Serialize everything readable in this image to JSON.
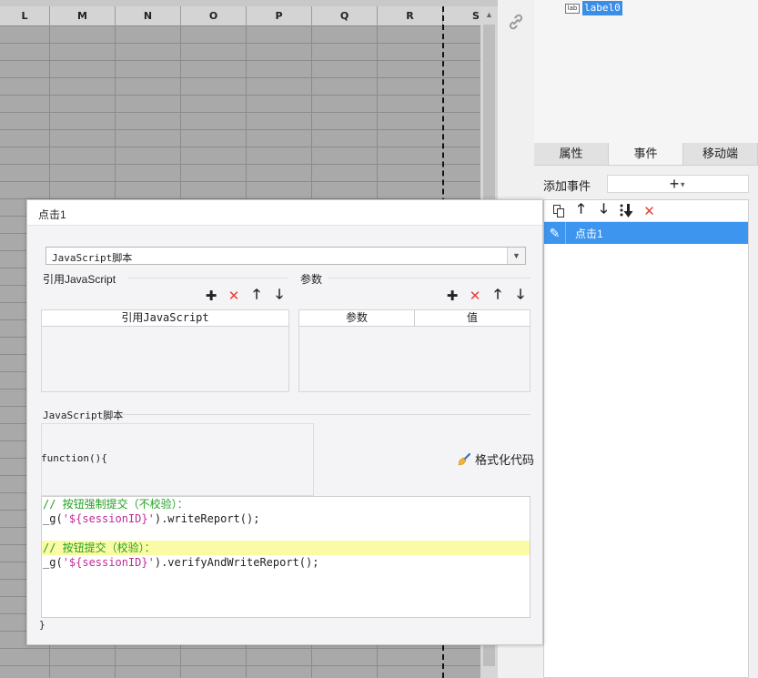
{
  "spreadsheet": {
    "columns": [
      "L",
      "M",
      "N",
      "O",
      "P",
      "Q",
      "R",
      "S"
    ]
  },
  "right_panel": {
    "tree": {
      "item_icon": "lab",
      "item_label": "label0"
    },
    "tabs": [
      "属性",
      "事件",
      "移动端"
    ],
    "active_tab": "事件",
    "add_event_label": "添加事件",
    "add_event_button": "+",
    "events": [
      {
        "name": "点击1"
      }
    ]
  },
  "dialog": {
    "title": "点击1",
    "script_type": "JavaScript脚本",
    "ref_js_section": "引用JavaScript",
    "params_section": "参数",
    "ref_table_header": "引用JavaScript",
    "params_headers": [
      "参数",
      "值"
    ],
    "script_section": "JavaScript脚本",
    "func_open": "function(){",
    "func_close": "}",
    "format_code_label": "格式化代码",
    "code_lines": [
      {
        "text": "// 按钮强制提交（不校验）：",
        "kind": "comment",
        "highlight": false
      },
      {
        "prefix": "_g(",
        "str": "'${sessionID}'",
        "suffix": ").writeReport();",
        "kind": "code",
        "highlight": false
      },
      {
        "text": "",
        "kind": "blank",
        "highlight": false
      },
      {
        "text": "// 按钮提交（校验）：",
        "kind": "comment",
        "highlight": true
      },
      {
        "prefix": "_g(",
        "str": "'${sessionID}'",
        "suffix": ").verifyAndWriteReport();",
        "kind": "code",
        "highlight": false
      }
    ]
  },
  "colors": {
    "accent": "#3d95f0",
    "delete": "#e8403a",
    "comment": "#22a022",
    "string": "#c02a9a",
    "highlight_line": "#fbfba5"
  }
}
